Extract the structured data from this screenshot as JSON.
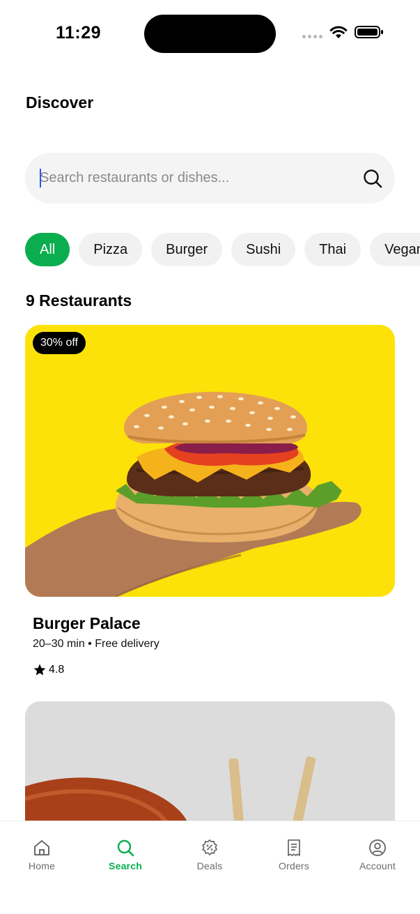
{
  "status_bar": {
    "time": "11:29"
  },
  "header": {
    "title": "Discover"
  },
  "search": {
    "placeholder": "Search restaurants or dishes...",
    "value": ""
  },
  "categories": [
    "All",
    "Pizza",
    "Burger",
    "Sushi",
    "Thai",
    "Vegan"
  ],
  "selected_category": "All",
  "results_heading": "9 Restaurants",
  "restaurants": [
    {
      "name": "Burger Palace",
      "badge": "30% off",
      "meta": "20–30 min • Free delivery",
      "rating": "4.8"
    }
  ],
  "tabs": [
    {
      "label": "Home",
      "icon": "home-icon"
    },
    {
      "label": "Search",
      "icon": "search-icon"
    },
    {
      "label": "Deals",
      "icon": "deals-icon"
    },
    {
      "label": "Orders",
      "icon": "receipt-icon"
    },
    {
      "label": "Account",
      "icon": "account-icon"
    }
  ],
  "active_tab": "Search",
  "colors": {
    "accent": "#0aae4f",
    "chip_bg": "#f1f1f1",
    "search_bg": "#f4f4f4",
    "badge_bg": "#000000",
    "card_bg": "#fde20a"
  }
}
